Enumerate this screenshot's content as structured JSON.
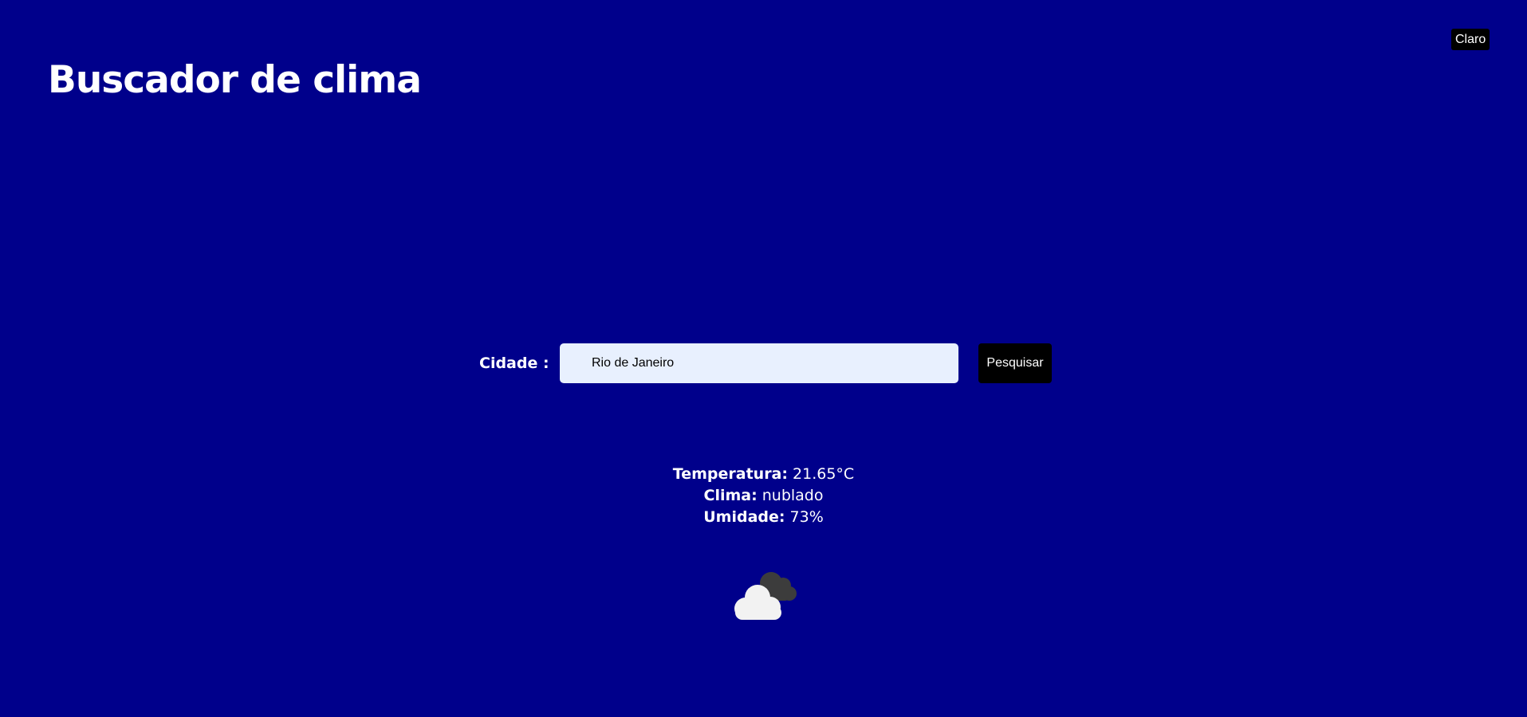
{
  "header": {
    "title": "Buscador de clima",
    "theme_toggle_label": "Claro"
  },
  "search": {
    "label": "Cidade :",
    "value": "Rio de Janeiro",
    "button_label": "Pesquisar"
  },
  "weather": {
    "temperature_label": "Temperatura:",
    "temperature_value": "21.65°C",
    "condition_label": "Clima:",
    "condition_value": "nublado",
    "humidity_label": "Umidade:",
    "humidity_value": "73%",
    "icon": "cloud-icon"
  },
  "colors": {
    "background": "#00008b",
    "text": "#ffffff",
    "button_background": "#000000",
    "input_background": "#e8f0fe"
  }
}
